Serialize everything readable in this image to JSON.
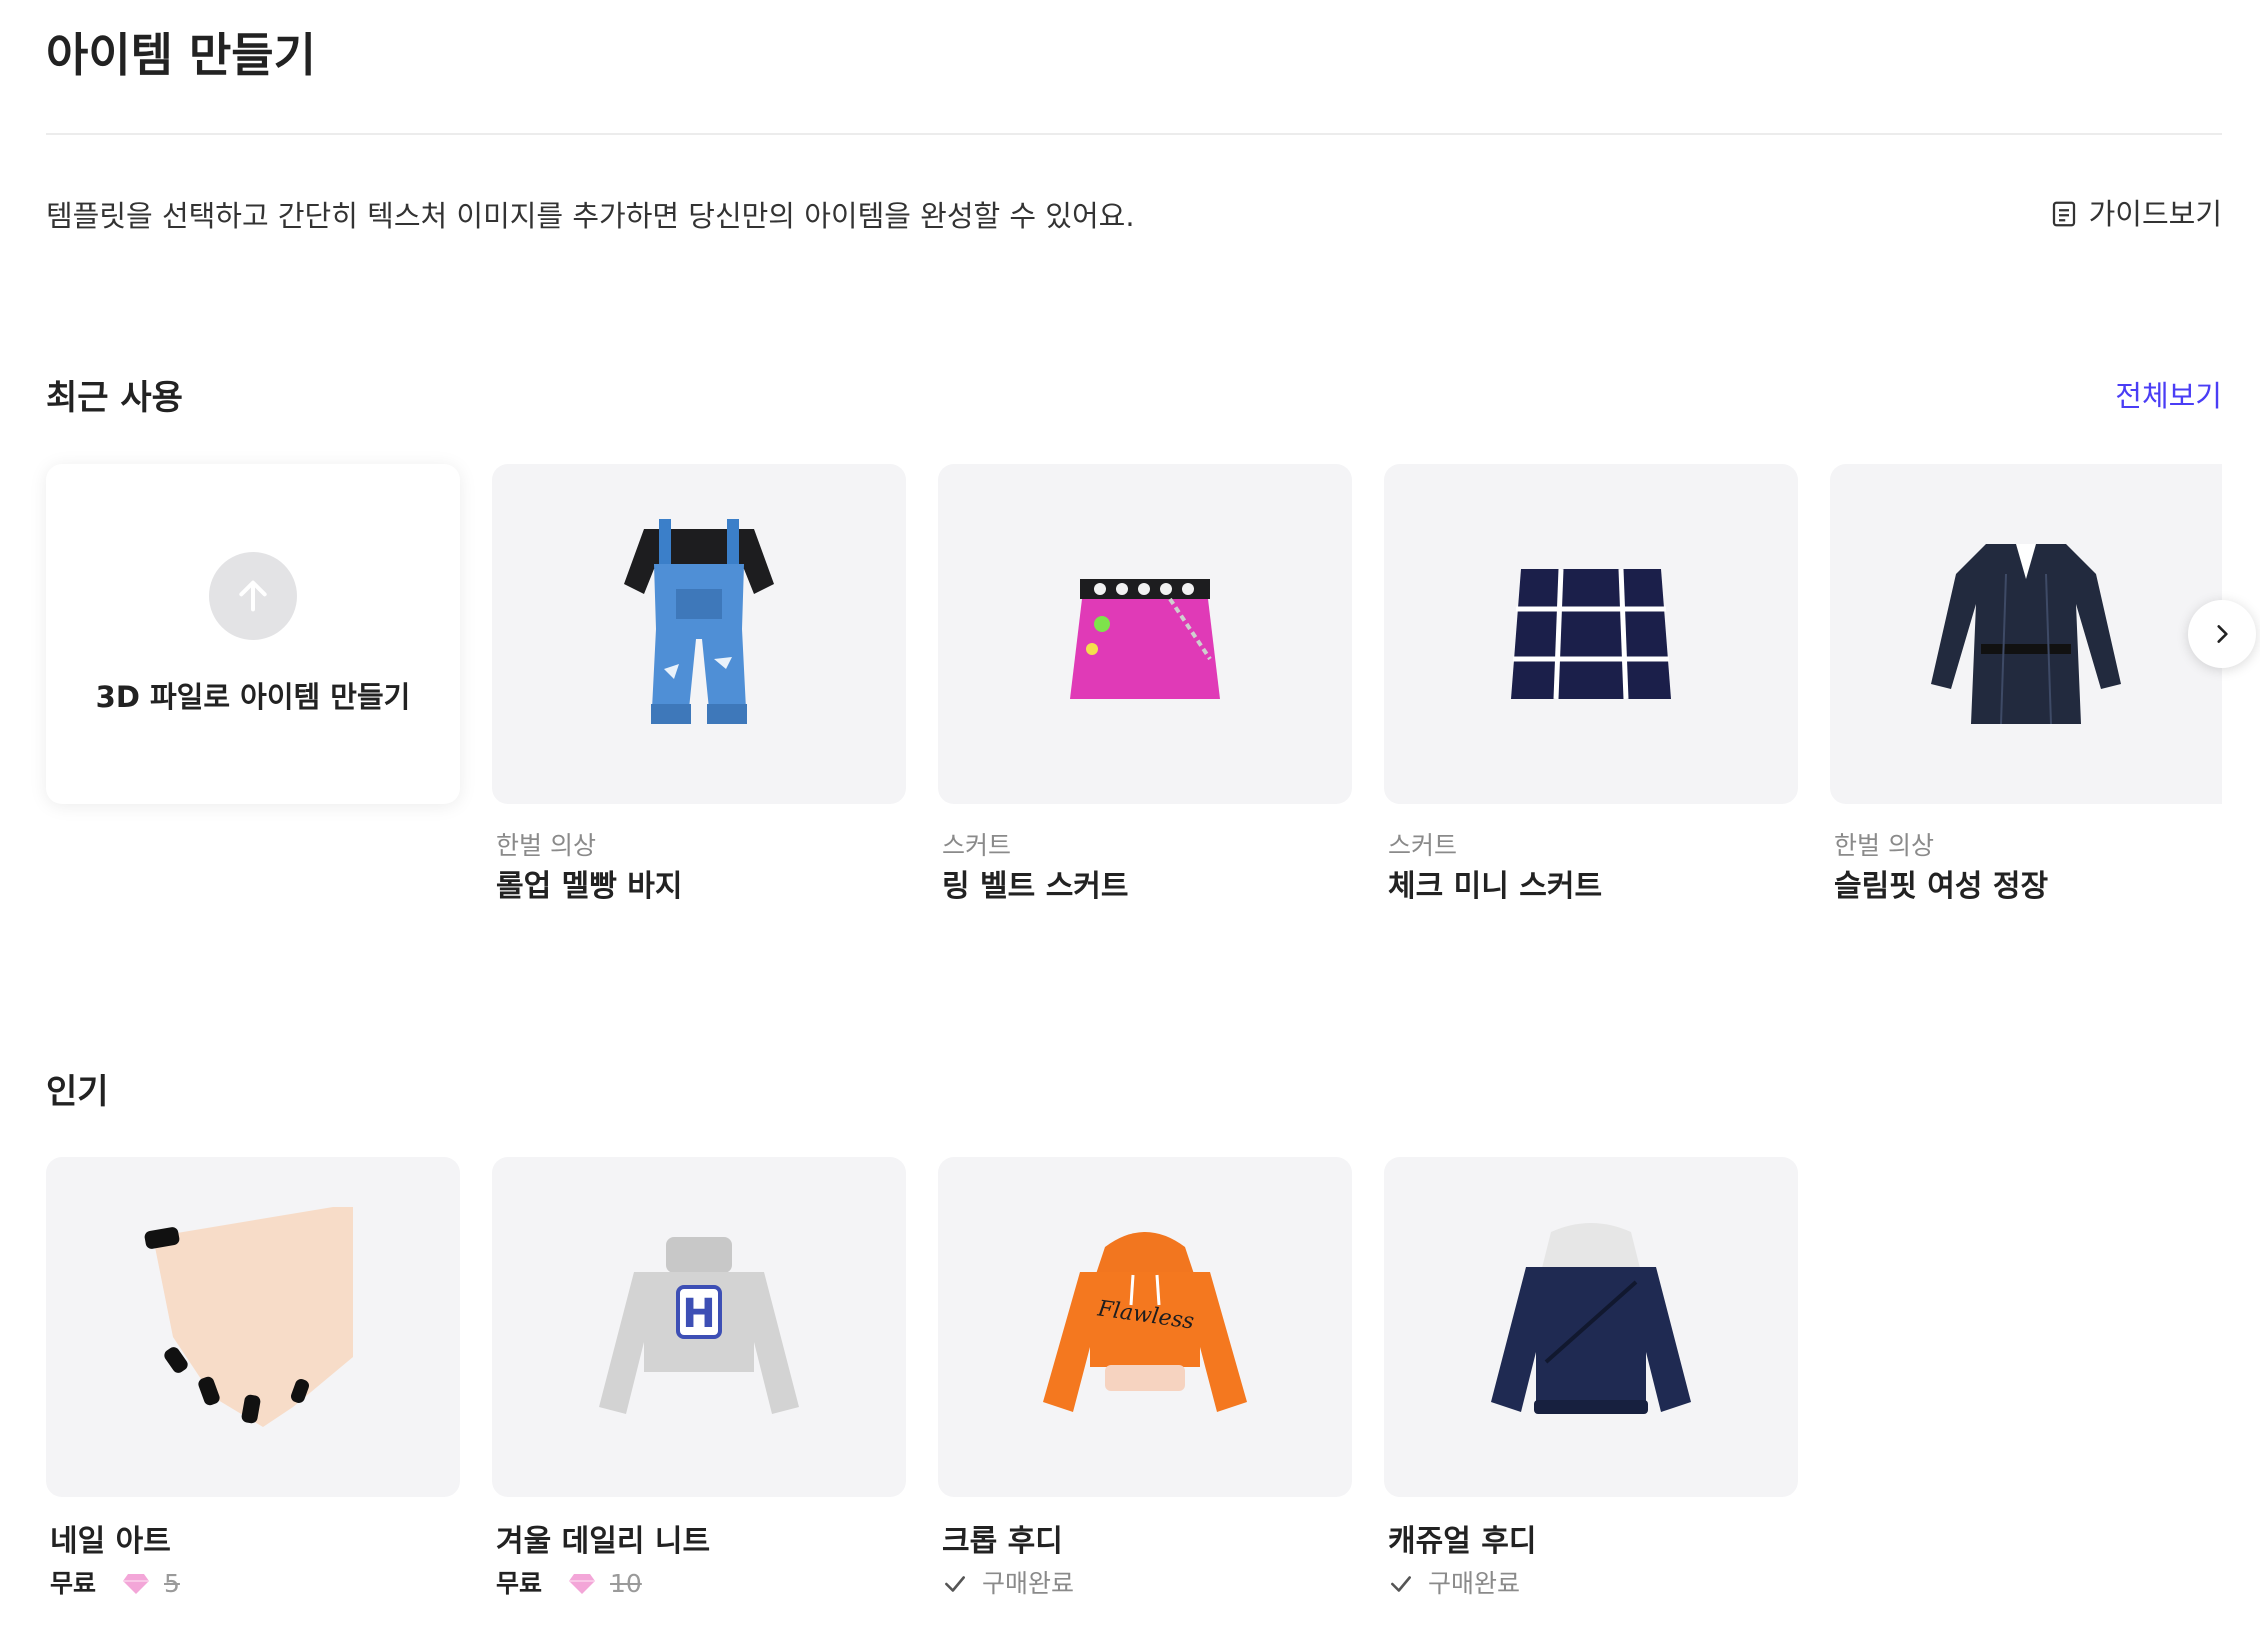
{
  "header": {
    "title": "아이템 만들기"
  },
  "intro": {
    "text": "템플릿을 선택하고 간단히 텍스처 이미지를 추가하면 당신만의 아이템을 완성할 수 있어요.",
    "guide_label": "가이드보기"
  },
  "recent": {
    "title": "최근 사용",
    "view_all": "전체보기",
    "upload_label": "3D 파일로 아이템 만들기",
    "items": [
      {
        "category": "한벌 의상",
        "name": "롤업 멜빵 바지"
      },
      {
        "category": "스커트",
        "name": "링 벨트 스커트"
      },
      {
        "category": "스커트",
        "name": "체크 미니 스커트"
      },
      {
        "category": "한벌 의상",
        "name": "슬림핏 여성 정장"
      }
    ]
  },
  "popular": {
    "title": "인기",
    "items": [
      {
        "name": "네일 아트",
        "price_label": "무료",
        "old_price": "5"
      },
      {
        "name": "겨울 데일리 니트",
        "price_label": "무료",
        "old_price": "10"
      },
      {
        "name": "크롭 후디",
        "status": "구매완료"
      },
      {
        "name": "캐쥬얼 후디",
        "status": "구매완료"
      }
    ]
  },
  "colors": {
    "accent": "#4a3df5",
    "card_bg": "#f4f4f6",
    "gem": "#f3a6d8"
  },
  "icons": [
    "guide-doc-icon",
    "upload-arrow-icon",
    "chevron-right-icon",
    "gem-icon",
    "check-icon"
  ]
}
